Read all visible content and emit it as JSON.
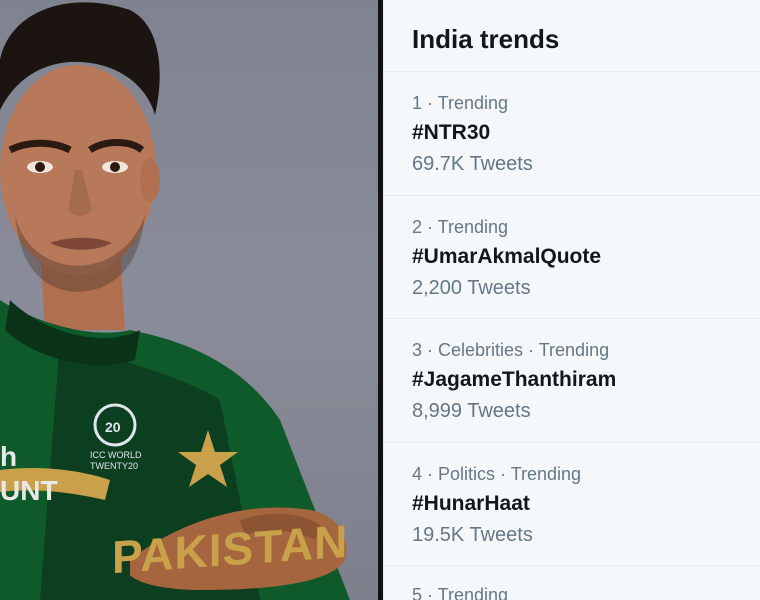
{
  "trends": {
    "title": "India trends",
    "items": [
      {
        "meta": "1 · Trending",
        "name": "#NTR30",
        "count": "69.7K Tweets"
      },
      {
        "meta": "2 · Trending",
        "name": "#UmarAkmalQuote",
        "count": "2,200 Tweets"
      },
      {
        "meta": "3 · Celebrities · Trending",
        "name": "#JagameThanthiram",
        "count": "8,999 Tweets"
      },
      {
        "meta": "4 · Politics · Trending",
        "name": "#HunarHaat",
        "count": "19.5K Tweets"
      },
      {
        "meta": "5 · Trending"
      }
    ]
  },
  "photo": {
    "jersey_text": "PAKISTAN",
    "badge_text": "ICC WORLD TWENTY20",
    "sponsor_text": "h UNT"
  },
  "colors": {
    "background": "#f5f8fa",
    "text_primary": "#14171a",
    "text_secondary": "#657786",
    "jersey_green": "#0f5a2a",
    "jersey_gold": "#c9a14a"
  }
}
